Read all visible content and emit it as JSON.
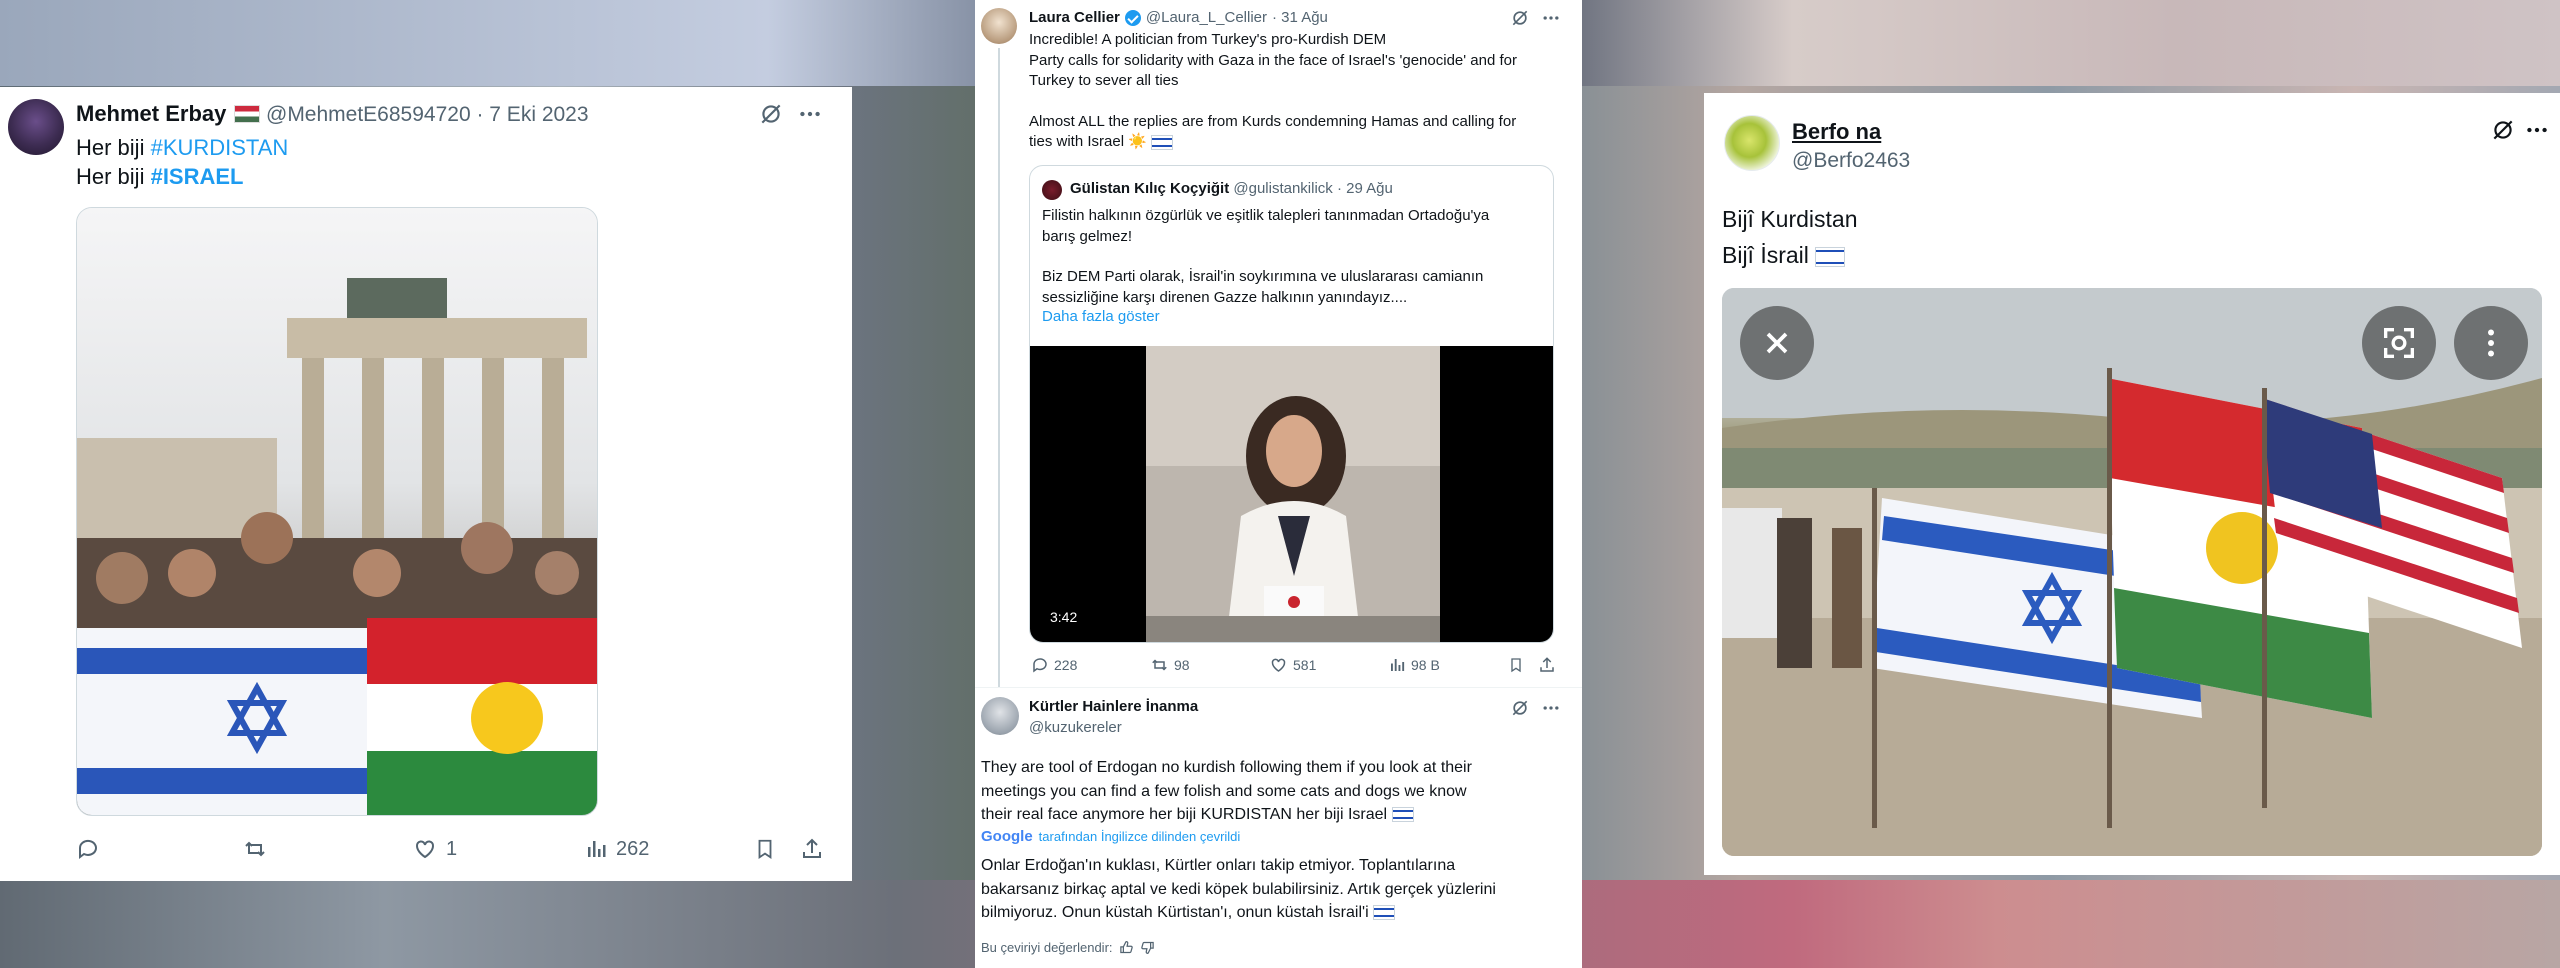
{
  "tweet_left": {
    "display_name": "Mehmet Erbay",
    "handle": "@MehmetE68594720",
    "date": "· 7 Eki 2023",
    "line1_prefix": "Her biji ",
    "line1_tag": "#KURDISTAN",
    "line2_prefix": "Her biji ",
    "line2_tag": "#ISRAEL",
    "actions": {
      "likes": "1",
      "views": "262"
    }
  },
  "tweet_middle": {
    "display_name": "Laura Cellier",
    "handle": "@Laura_L_Cellier",
    "date": "· 31 Ağu",
    "text_line1": "Incredible! A politician from Turkey's pro-Kurdish DEM",
    "text_line2": "Party calls for solidarity with Gaza in the face of Israel's 'genocide' and for",
    "text_line3": "Turkey to sever all ties",
    "text_line4": "Almost ALL the replies are from Kurds condemning Hamas and calling for",
    "text_line5": "ties with Israel ☀️",
    "quote": {
      "display_name": "Gülistan Kılıç Koçyiğit",
      "handle": "@gulistankilick",
      "date": "· 29 Ağu",
      "text_line1": "Filistin halkının özgürlük ve eşitlik talepleri tanınmadan Ortadoğu'ya",
      "text_line2": "barış gelmez!",
      "text_line3": "Biz DEM Parti olarak, İsrail'in soykırımına ve uluslararası camianın",
      "text_line4": "sessizliğine karşı direnen Gazze halkının yanındayız....",
      "show_more": "Daha fazla göster",
      "video_duration": "3:42"
    },
    "actions": {
      "replies": "228",
      "reposts": "98",
      "likes": "581",
      "views": "98 B"
    },
    "reply": {
      "display_name": "Kürtler Hainlere İnanma",
      "handle": "@kuzukereler",
      "text_line1": "They are tool of Erdogan no kurdish following them if you look at their",
      "text_line2": "meetings you can find a few folish and some cats and dogs we know",
      "text_line3": "their real face anymore her biji KURDISTAN  her biji Israel",
      "google_label": "Google",
      "translated_label": "tarafından İngilizce dilinden çevrildi",
      "translation_line1": "Onlar Erdoğan'ın kuklası, Kürtler onları takip etmiyor. Toplantılarına",
      "translation_line2": "bakarsanız birkaç aptal ve kedi köpek bulabilirsiniz. Artık gerçek yüzlerini",
      "translation_line3": "bilmiyoruz. Onun küstah Kürtistan'ı, onun küstah İsrail'i",
      "rate_label": "Bu çeviriyi değerlendir:"
    }
  },
  "tweet_right": {
    "display_name": "Berfo na",
    "handle": "@Berfo2463",
    "line1": "Bijî Kurdistan",
    "line2": "Bijî İsrail"
  },
  "colors": {
    "accent": "#1d9bf0",
    "muted": "#536471",
    "text": "#0f1419"
  }
}
